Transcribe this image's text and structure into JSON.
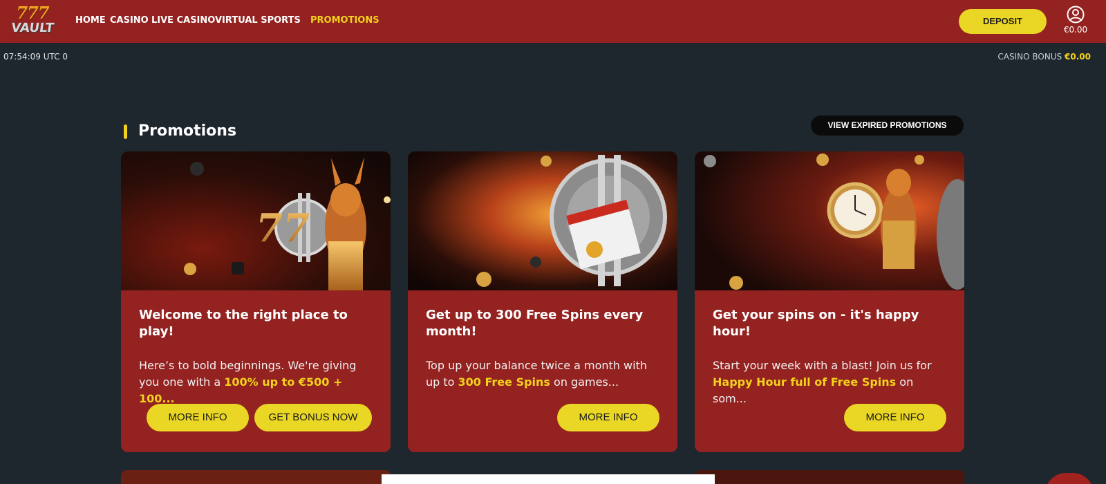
{
  "logo": {
    "sevens": "777",
    "word": "VAULT"
  },
  "nav": {
    "items": [
      {
        "label": "HOME"
      },
      {
        "label": "CASINO"
      },
      {
        "label": "LIVE CASINO"
      },
      {
        "label": "VIRTUAL SPORTS"
      },
      {
        "label": "PROMOTIONS",
        "active": true
      }
    ]
  },
  "header": {
    "deposit_label": "DEPOSIT",
    "account_icon": "user-circle-icon",
    "balance": "€0.00"
  },
  "status": {
    "time": "07:54:09 UTC 0",
    "casino_bonus_label": "CASINO BONUS",
    "casino_bonus_value": "€0.00"
  },
  "section": {
    "title": "Promotions",
    "expired_label": "VIEW EXPIRED PROMOTIONS"
  },
  "cards": [
    {
      "title": "Welcome to the right place to play!",
      "text_before": "Here’s to bold beginnings. We're giving you one with a ",
      "text_highlight": "100% up to €500 + 100...",
      "text_after": "",
      "buttons": [
        "MORE INFO",
        "GET BONUS NOW"
      ],
      "image": "fox-with-vault-777"
    },
    {
      "title": "Get up to 300 Free Spins every month!",
      "text_before": "Top up your balance twice a month with up to ",
      "text_highlight": "300 Free Spins",
      "text_after": " on games...",
      "buttons": [
        "MORE INFO"
      ],
      "image": "vault-with-calendar"
    },
    {
      "title": "Get your spins on - it's happy hour!",
      "text_before": "Start your week with a blast! Join us for ",
      "text_highlight": "Happy Hour full of Free Spins",
      "text_after": " on som...",
      "buttons": [
        "MORE INFO"
      ],
      "image": "fox-with-clock"
    }
  ],
  "colors": {
    "brand_red": "#932220",
    "accent_yellow": "#ead625",
    "background": "#1e272e"
  }
}
